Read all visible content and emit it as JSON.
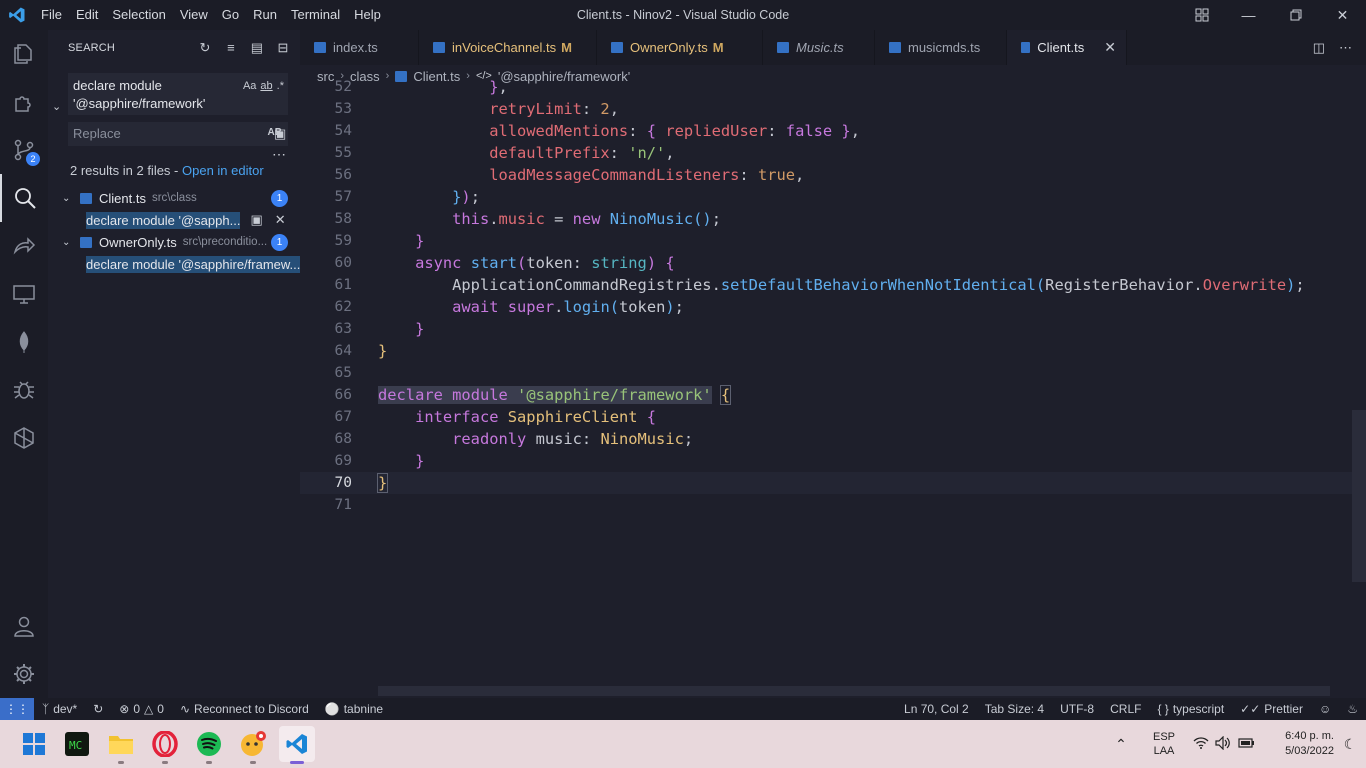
{
  "window": {
    "title": "Client.ts - Ninov2 - Visual Studio Code",
    "menu": [
      "File",
      "Edit",
      "Selection",
      "View",
      "Go",
      "Run",
      "Terminal",
      "Help"
    ]
  },
  "activity_bar": {
    "source_control_badge": "2"
  },
  "sidebar": {
    "header": "SEARCH",
    "search_value": "declare module '@sapphire/framework'",
    "search_value_line1": "declare module",
    "search_value_line2": "'@sapphire/framework'",
    "search_options": [
      "Aa",
      "ab",
      ".*"
    ],
    "replace_placeholder": "Replace",
    "replace_option": "AB",
    "results_summary": "2 results in 2 files - ",
    "open_in_editor": "Open in editor",
    "results": [
      {
        "file": "Client.ts",
        "path": "src\\class",
        "count": "1",
        "match": "declare module '@sapph..."
      },
      {
        "file": "OwnerOnly.ts",
        "path": "src\\preconditio...",
        "count": "1",
        "match": "declare module '@sapphire/framew..."
      }
    ]
  },
  "tabs": [
    {
      "label": "index.ts",
      "modified": false,
      "italic": false,
      "active": false
    },
    {
      "label": "inVoiceChannel.ts",
      "modified": true,
      "italic": false,
      "active": false
    },
    {
      "label": "OwnerOnly.ts",
      "modified": true,
      "italic": false,
      "active": false
    },
    {
      "label": "Music.ts",
      "modified": false,
      "italic": true,
      "active": false
    },
    {
      "label": "musicmds.ts",
      "modified": false,
      "italic": false,
      "active": false
    },
    {
      "label": "Client.ts",
      "modified": false,
      "italic": false,
      "active": true
    }
  ],
  "tab_modified_marker": "M",
  "breadcrumb": [
    "src",
    "class",
    "Client.ts",
    "'@sapphire/framework'"
  ],
  "editor": {
    "line_numbers": [
      "52",
      "53",
      "54",
      "55",
      "56",
      "57",
      "58",
      "59",
      "60",
      "61",
      "62",
      "63",
      "64",
      "65",
      "66",
      "67",
      "68",
      "69",
      "70",
      "71"
    ],
    "current_line": "70",
    "lines": [
      "            },",
      "            retryLimit: 2,",
      "            allowedMentions: { repliedUser: false },",
      "            defaultPrefix: 'n/',",
      "            loadMessageCommandListeners: true,",
      "        });",
      "        this.music = new NinoMusic();",
      "    }",
      "    async start(token: string) {",
      "        ApplicationCommandRegistries.setDefaultBehaviorWhenNotIdentical(RegisterBehavior.Overwrite);",
      "        await super.login(token);",
      "    }",
      "}",
      "",
      "declare module '@sapphire/framework' {",
      "    interface SapphireClient {",
      "        readonly music: NinoMusic;",
      "    }",
      "}",
      ""
    ]
  },
  "statusbar": {
    "branch": "dev*",
    "errors": "0",
    "warnings": "0",
    "discord": "Reconnect to Discord",
    "tabnine": "tabnine",
    "position": "Ln 70, Col 2",
    "tab_size": "Tab Size: 4",
    "encoding": "UTF-8",
    "eol": "CRLF",
    "language": "typescript",
    "formatter": "Prettier"
  },
  "taskbar": {
    "lang_top": "ESP",
    "lang_bottom": "LAA",
    "time": "6:40 p. m.",
    "date": "5/03/2022",
    "apps": [
      "windows-start",
      "terminal-app",
      "file-explorer",
      "opera-browser",
      "spotify",
      "messaging-app",
      "vscode"
    ]
  },
  "colors": {
    "editor_bg": "#1e1f2b",
    "keyword": "#c678dd",
    "property": "#e06c75",
    "number": "#d19a66",
    "string": "#98c379",
    "function": "#61afef",
    "type": "#e5c07b",
    "accent_blue": "#3b82f6",
    "remote_blue": "#3a6ec9"
  }
}
